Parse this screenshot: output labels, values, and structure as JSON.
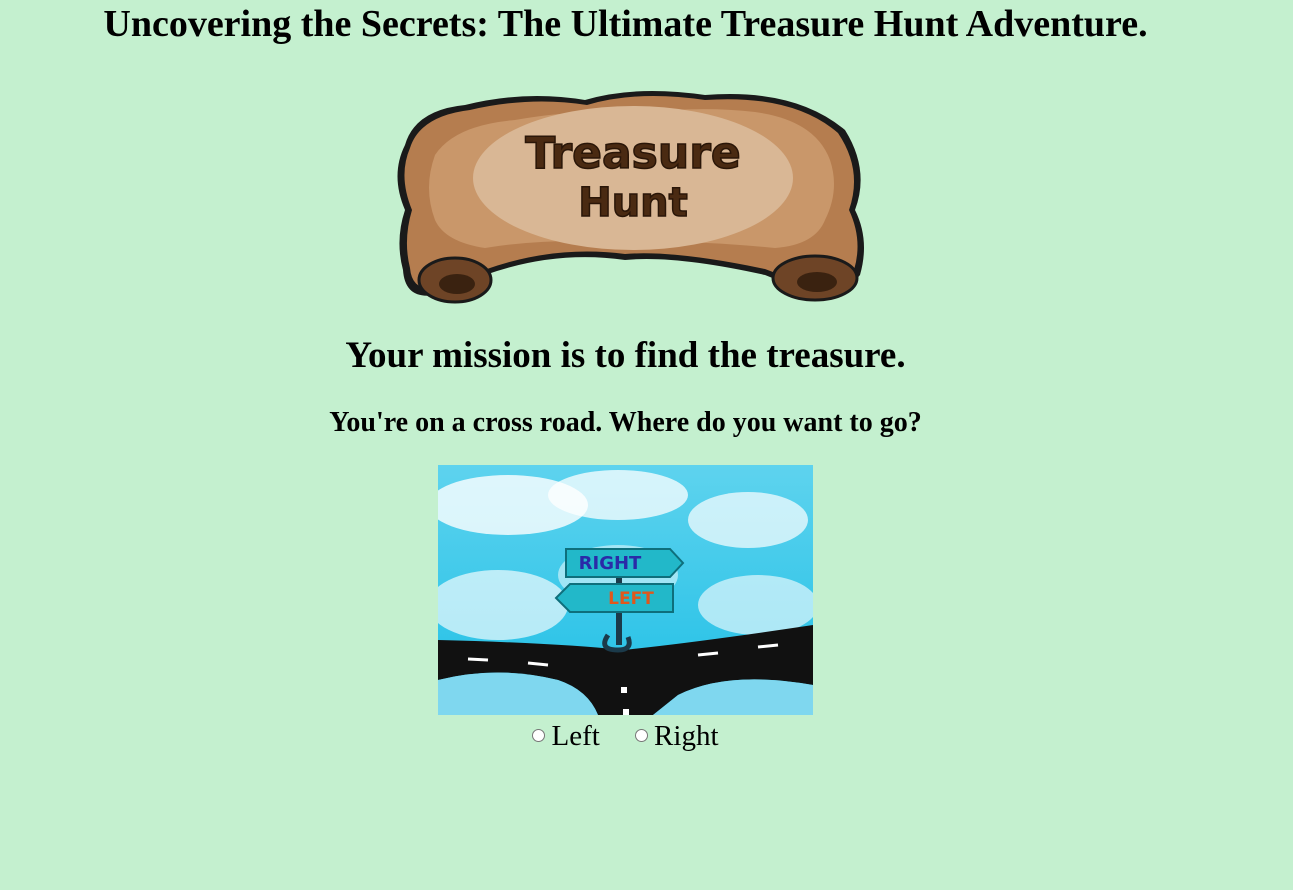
{
  "page": {
    "title": "Uncovering the Secrets: The Ultimate Treasure Hunt Adventure.",
    "background_color": "#c4f0cf"
  },
  "banner": {
    "line1": "Treasure",
    "line2": "Hunt",
    "scroll_color": "#d9b795",
    "text_color": "#4a2a12"
  },
  "mission": {
    "heading": "Your mission is to find the treasure.",
    "question": "You're on a cross road. Where do you want to go?"
  },
  "crossroad_image": {
    "sign_top": "RIGHT",
    "sign_bottom": "LEFT",
    "sky_color": "#3cc8e8"
  },
  "choices": [
    {
      "label": "Left",
      "value": "left",
      "selected": false
    },
    {
      "label": "Right",
      "value": "right",
      "selected": false
    }
  ]
}
